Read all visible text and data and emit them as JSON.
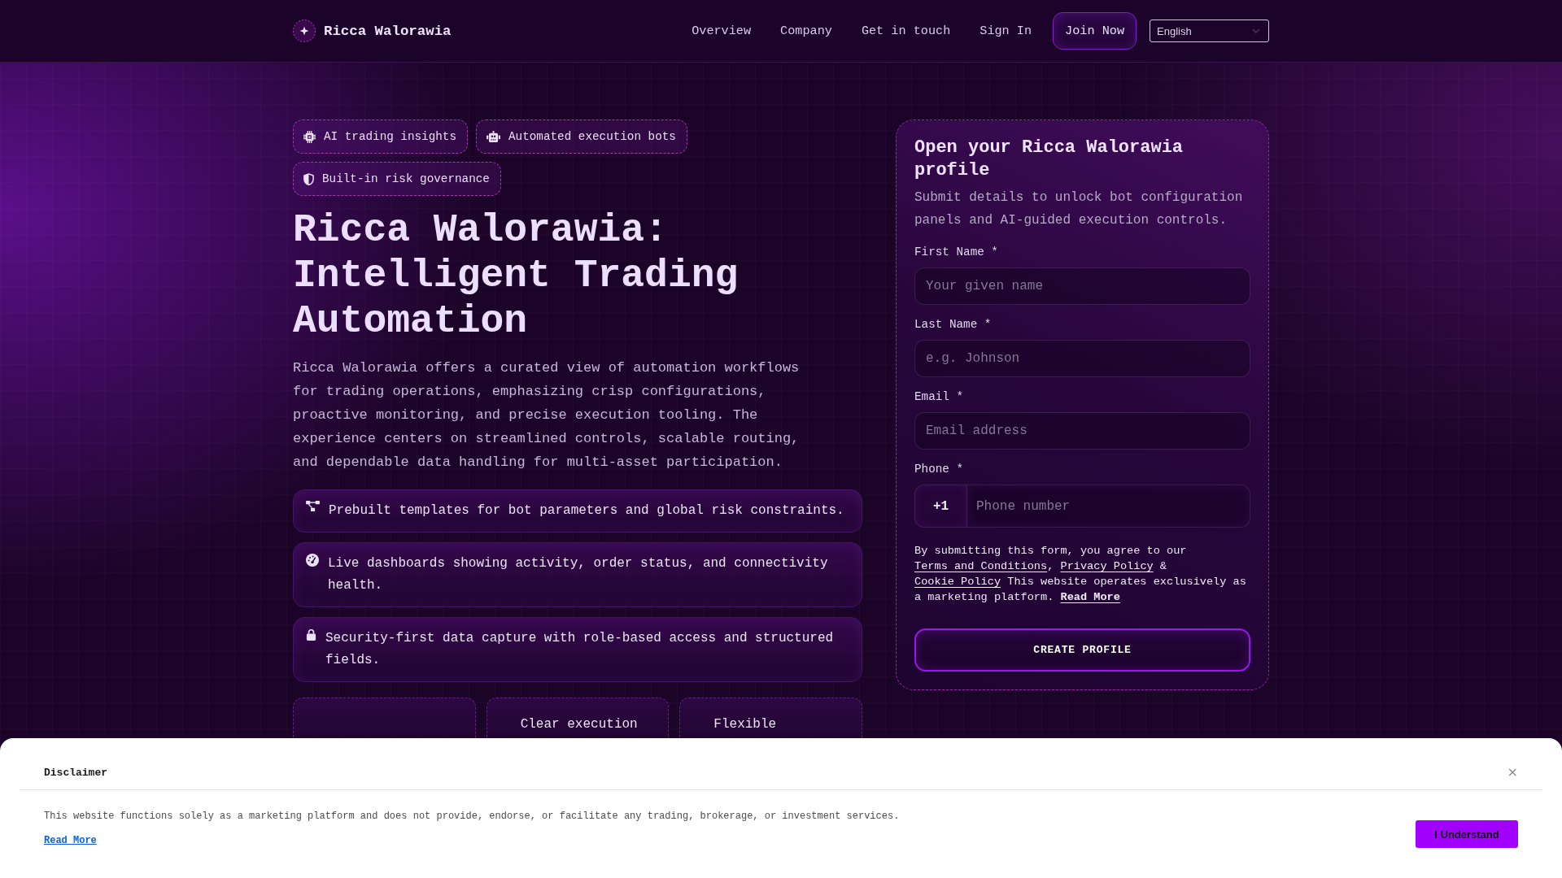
{
  "header": {
    "brand": "Ricca Walorawia",
    "nav": [
      {
        "label": "Overview"
      },
      {
        "label": "Company"
      },
      {
        "label": "Get in touch"
      },
      {
        "label": "Sign In"
      }
    ],
    "cta": "Join Now",
    "language": "English"
  },
  "hero": {
    "badges": [
      {
        "label": "AI trading insights"
      },
      {
        "label": "Automated execution bots"
      },
      {
        "label": "Built-in risk governance"
      }
    ],
    "title": "Ricca Walorawia: Intelligent Trading Automation",
    "description": "Ricca Walorawia offers a curated view of automation workflows for trading operations, emphasizing crisp configurations, proactive monitoring, and precise execution tooling. The experience centers on streamlined controls, scalable routing, and dependable data handling for multi-asset participation.",
    "features": [
      {
        "text": "Prebuilt templates for bot parameters and global risk constraints."
      },
      {
        "text": "Live dashboards showing activity, order status, and connectivity health."
      },
      {
        "text": "Security-first data capture with role-based access and structured fields."
      }
    ],
    "highlights": [
      {
        "kind": "covered"
      },
      {
        "kind": "text",
        "label": "Clear execution"
      },
      {
        "kind": "text",
        "label": "Flexible"
      }
    ]
  },
  "signup": {
    "title": "Open your Ricca Walorawia profile",
    "subtitle": "Submit details to unlock bot configuration panels and AI-guided execution controls.",
    "fields": [
      {
        "kind": "text",
        "label": "First Name *",
        "placeholder": "Your given name"
      },
      {
        "kind": "text",
        "label": "Last Name *",
        "placeholder": "e.g. Johnson"
      },
      {
        "kind": "text",
        "label": "Email *",
        "placeholder": "Email address"
      },
      {
        "kind": "phone",
        "label": "Phone *",
        "prefix": "+1",
        "placeholder": "Phone number"
      }
    ],
    "consent": [
      {
        "kind": "text",
        "text": "By submitting this form, you agree to our "
      },
      {
        "kind": "link",
        "text": "Terms and Conditions",
        "bold": false
      },
      {
        "kind": "text",
        "text": ", "
      },
      {
        "kind": "link",
        "text": "Privacy Policy",
        "bold": false
      },
      {
        "kind": "text",
        "text": " & "
      },
      {
        "kind": "link",
        "text": "Cookie Policy",
        "bold": false
      },
      {
        "kind": "text",
        "text": " This website operates exclusively as a marketing platform. "
      },
      {
        "kind": "link",
        "text": "Read More",
        "bold": true
      }
    ],
    "submit": "CREATE PROFILE"
  },
  "disclaimer": {
    "title": "Disclaimer",
    "close": "×",
    "text": "This website functions solely as a marketing platform and does not provide, endorse, or facilitate any trading, brokerage, or investment services.",
    "link": "Read More",
    "button": "I Understand"
  }
}
